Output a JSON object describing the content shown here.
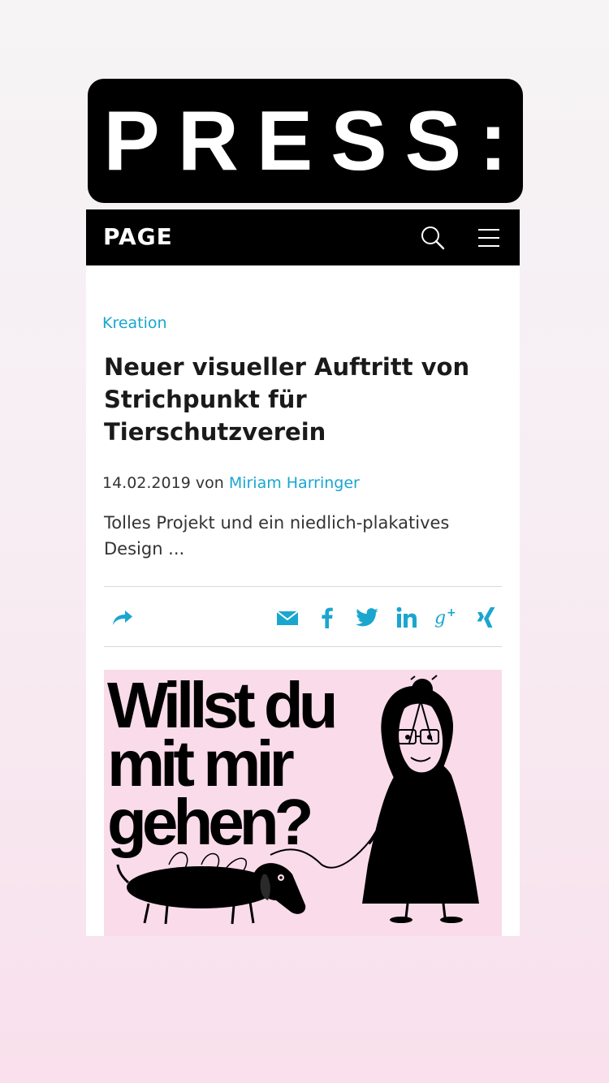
{
  "banner": {
    "text": "PRESS:"
  },
  "site": {
    "logo": "PAGE"
  },
  "header_icons": [
    "search-icon",
    "menu-icon"
  ],
  "article": {
    "category": "Kreation",
    "title": "Neuer visueller Auftritt von Strichpunkt für Tierschutzverein",
    "date": "14.02.2019",
    "by": "von",
    "author": "Miriam Harringer",
    "teaser": "Tolles Projekt und ein niedlich-plakatives Design ..."
  },
  "share_icons": [
    "share-arrow-icon",
    "mail-icon",
    "facebook-icon",
    "twitter-icon",
    "linkedin-icon",
    "google-plus-icon",
    "xing-icon"
  ],
  "image_text": {
    "line1": "Willst du",
    "line2": "mit mir",
    "line3": "gehen?"
  },
  "colors": {
    "accent": "#1aa6cf",
    "header_bg": "#000000",
    "image_bg": "#fadbe9"
  }
}
